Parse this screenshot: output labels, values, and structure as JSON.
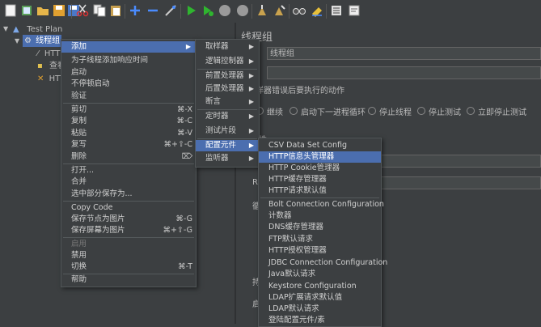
{
  "toolbar": {
    "icons": [
      "new-icon",
      "templates-icon",
      "open-icon",
      "save-icon",
      "save-as-icon",
      "cut-icon",
      "copy-icon",
      "paste-icon",
      "expand-icon",
      "collapse-icon",
      "toggle-icon",
      "start-icon",
      "start-no-pause-icon",
      "stop-icon",
      "shutdown-icon",
      "clear-icon",
      "clear-all-icon",
      "search-icon",
      "reset-search-icon",
      "function-helper-icon",
      "help-icon"
    ]
  },
  "tree": {
    "root": "Test Plan",
    "thread_group": "线程组",
    "child1": "HTT",
    "child2": "查看",
    "child3": "HTT"
  },
  "right_panel": {
    "title": "线程组",
    "name_value": "线程组",
    "error_action_label": "样器错误后要执行的动作",
    "radio_continue": "继续",
    "radio_next_loop": "启动下一进程循环",
    "radio_stop_thread": "停止线程",
    "radio_stop_test": "停止测试",
    "radio_stop_now": "立即停止测试",
    "partial_label_1": "属性",
    "partial_label_2": "R",
    "partial_label_3": "循",
    "partial_label_4": "持",
    "partial_label_5": "启"
  },
  "menu1": {
    "add": "添加",
    "add_think_time": "为子线程添加响应时间",
    "start": "启动",
    "start_no_pause": "不停顿启动",
    "validate": "验证",
    "cut": "剪切",
    "cut_sc": "⌘-X",
    "copy": "复制",
    "copy_sc": "⌘-C",
    "paste": "粘贴",
    "paste_sc": "⌘-V",
    "duplicate": "复写",
    "duplicate_sc": "⌘+⇧-C",
    "delete": "删除",
    "delete_sc": "⌦",
    "open": "打开...",
    "merge": "合并",
    "save_selection": "选中部分保存为...",
    "copy_code": "Copy Code",
    "save_node_image": "保存节点为图片",
    "save_node_image_sc": "⌘-G",
    "save_screen_image": "保存屏幕为图片",
    "save_screen_image_sc": "⌘+⇧-G",
    "enable": "启用",
    "disable": "禁用",
    "toggle": "切换",
    "toggle_sc": "⌘-T",
    "help": "帮助"
  },
  "menu2": {
    "sampler": "取样器",
    "logic_controller": "逻辑控制器",
    "pre_processor": "前置处理器",
    "post_processor": "后置处理器",
    "assertion": "断言",
    "timer": "定时器",
    "test_fragment": "测试片段",
    "config_element": "配置元件",
    "listener": "监听器"
  },
  "menu3": {
    "items": [
      "CSV Data Set Config",
      "HTTP信息头管理器",
      "HTTP Cookie管理器",
      "HTTP缓存管理器",
      "HTTP请求默认值",
      "Bolt Connection Configuration",
      "计数器",
      "DNS缓存管理器",
      "FTP默认请求",
      "HTTP授权管理器",
      "JDBC Connection Configuration",
      "Java默认请求",
      "Keystore Configuration",
      "LDAP扩展请求默认值",
      "LDAP默认请求",
      "登陆配置元件/素"
    ]
  }
}
